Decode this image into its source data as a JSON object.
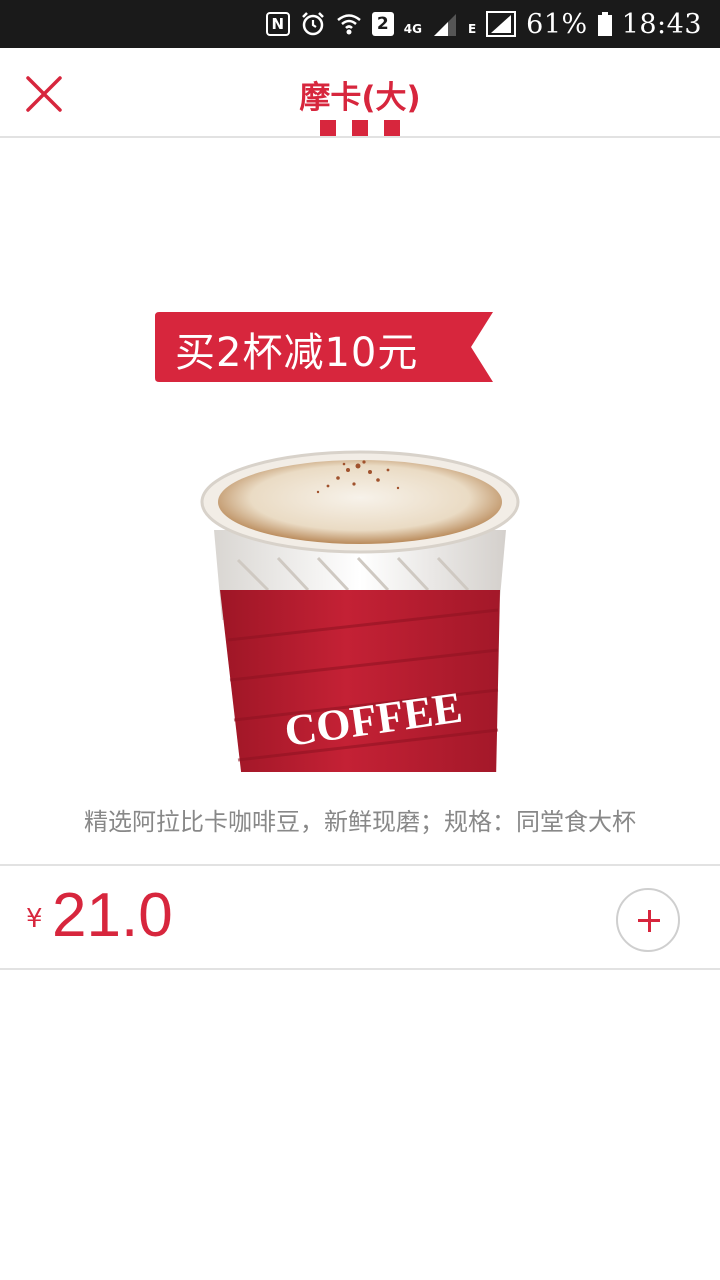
{
  "status_bar": {
    "nfc_label": "N",
    "sim_label": "2",
    "network_4g": "4G",
    "network_e": "E",
    "battery_percent": "61%",
    "time": "18:43",
    "icons": [
      "nfc-icon",
      "alarm-icon",
      "wifi-icon",
      "sim2-icon",
      "signal-icon",
      "battery-icon"
    ]
  },
  "header": {
    "title": "摩卡(大)",
    "close_icon": "close-icon"
  },
  "product": {
    "promo_badge": "买2杯减10元",
    "cup_brand": "COFFEE",
    "description": "精选阿拉比卡咖啡豆，新鲜现磨；规格：同堂食大杯",
    "currency_symbol": "¥",
    "price": "21.0",
    "add_icon": "plus-icon"
  },
  "colors": {
    "accent": "#d7263d",
    "cup_red": "#b81d2f",
    "text_gray": "#888888",
    "divider": "#e2e2e2",
    "status_bar": "#1a1a1a"
  }
}
